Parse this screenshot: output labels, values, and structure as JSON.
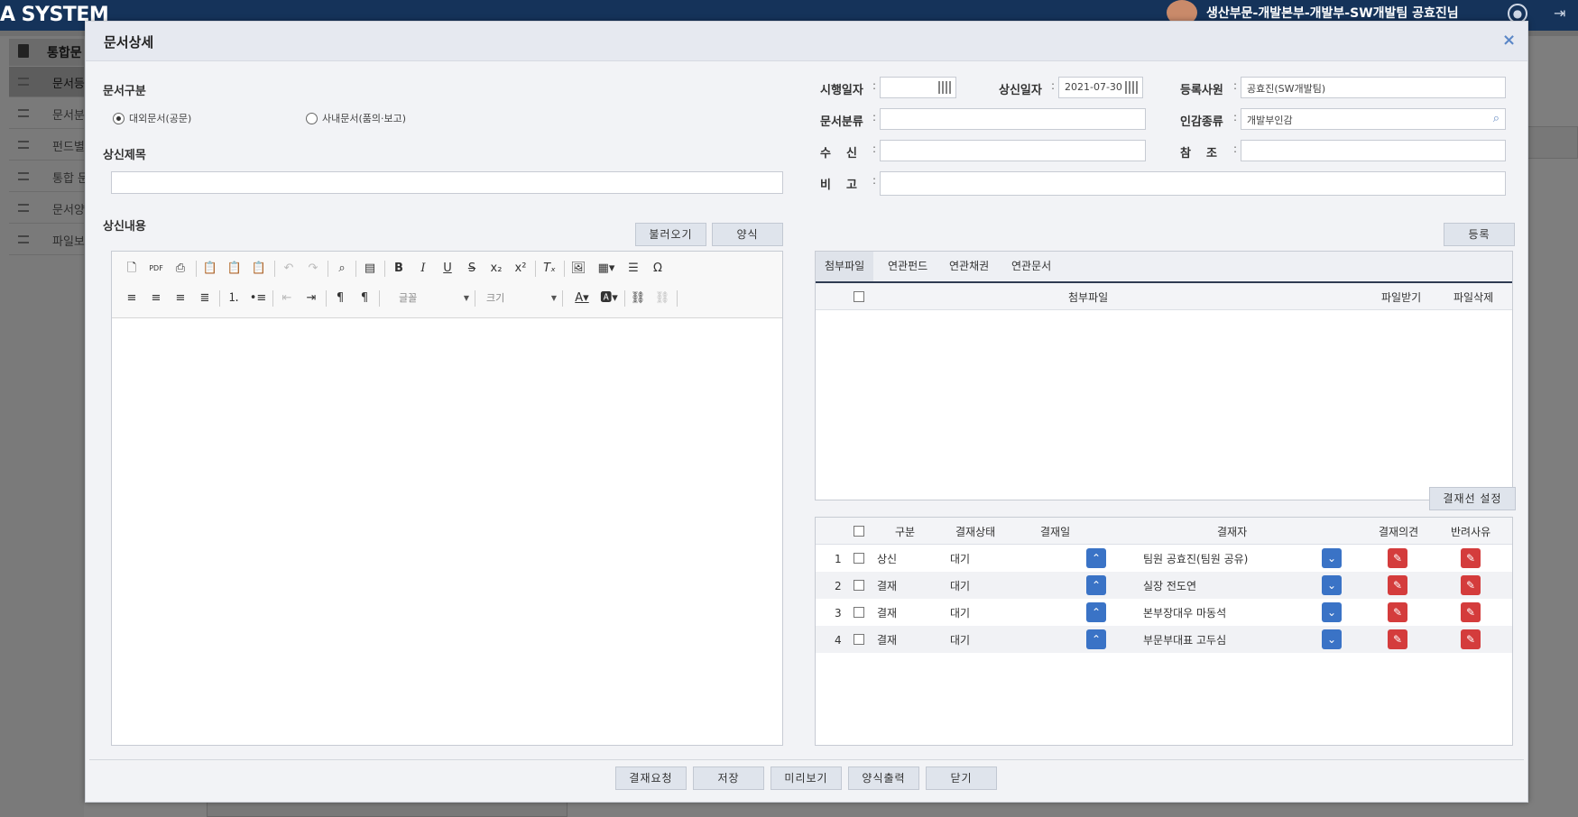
{
  "app": {
    "title": "A SYSTEM",
    "user": "생산부문-개발본부-개발부-SW개발팀 공효진님"
  },
  "sidebar": {
    "header": "통합문",
    "items": [
      {
        "label": "문서등"
      },
      {
        "label": "문서분"
      },
      {
        "label": "펀드별"
      },
      {
        "label": "통합 문"
      },
      {
        "label": "문서양"
      },
      {
        "label": "파일보"
      }
    ]
  },
  "modal": {
    "title": "문서상세",
    "close": "×",
    "doc_type": {
      "label": "문서구분",
      "options": [
        "대외문서(공문)",
        "사내문서(품의·보고)"
      ],
      "selected": "대외문서(공문)"
    },
    "subject": {
      "label": "상신제목",
      "value": ""
    },
    "content": {
      "label": "상신내용"
    },
    "buttons": {
      "load": "불러오기",
      "template": "양식",
      "register": "등록",
      "approval_line": "결재선 설정"
    },
    "fields": {
      "exec_date": {
        "label": "시행일자",
        "value": ""
      },
      "submit_date": {
        "label": "상신일자",
        "value": "2021-07-30"
      },
      "registrant": {
        "label": "등록사원",
        "value": "공효진(SW개발팀)"
      },
      "doc_class": {
        "label": "문서분류",
        "value": ""
      },
      "seal_type": {
        "label": "인감종류",
        "value": "개발부인감"
      },
      "recipient": {
        "label": "수　신",
        "value": ""
      },
      "reference": {
        "label": "참　조",
        "value": ""
      },
      "remark": {
        "label": "비　고",
        "value": ""
      }
    },
    "editor": {
      "font_placeholder": "글꼴",
      "size_placeholder": "크기"
    },
    "attach_tabs": [
      "첨부파일",
      "연관펀드",
      "연관채권",
      "연관문서"
    ],
    "attach_headers": [
      "첨부파일",
      "파일받기",
      "파일삭제"
    ],
    "approval_headers": [
      "구분",
      "결재상태",
      "결재일",
      "결재자",
      "결재의견",
      "반려사유"
    ],
    "approval_rows": [
      {
        "no": "1",
        "type": "상신",
        "status": "대기",
        "date": "",
        "approver": "팀원 공효진(팀원 공유)"
      },
      {
        "no": "2",
        "type": "결재",
        "status": "대기",
        "date": "",
        "approver": "실장 전도연"
      },
      {
        "no": "3",
        "type": "결재",
        "status": "대기",
        "date": "",
        "approver": "본부장대우 마동석"
      },
      {
        "no": "4",
        "type": "결재",
        "status": "대기",
        "date": "",
        "approver": "부문부대표 고두심"
      }
    ],
    "footer": {
      "request": "결재요청",
      "save": "저장",
      "preview": "미리보기",
      "print": "양식출력",
      "close": "닫기"
    }
  },
  "colors": {
    "header_bg": "#15335a",
    "blue_btn": "#3a73c6",
    "red_btn": "#d43c3c",
    "tab_underline": "#2f3b52"
  }
}
